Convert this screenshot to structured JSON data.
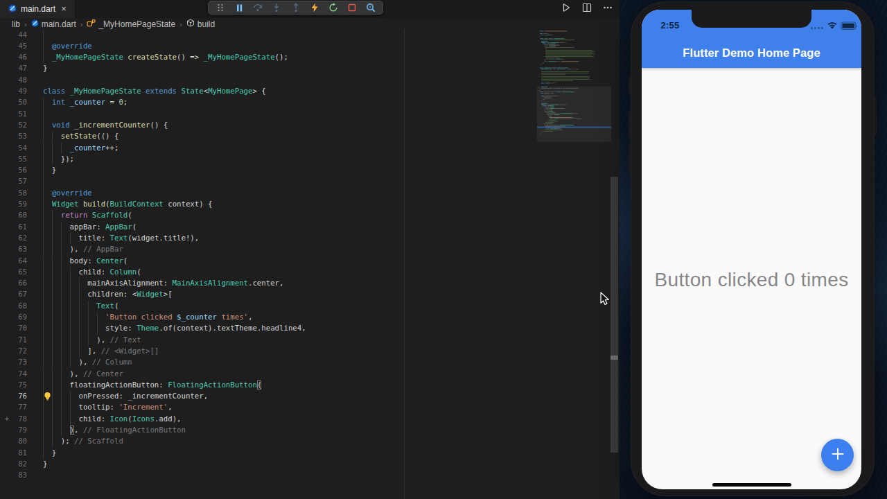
{
  "colors": {
    "p": "#d4d4d4",
    "k": "#569cd6",
    "c": "#c586c0",
    "t": "#4ec9b0",
    "f": "#dcdcaa",
    "v": "#9cdcfe",
    "n": "#b5cea8",
    "s": "#ce9178",
    "m": "#7a7a7a"
  },
  "vscode": {
    "tab": {
      "title": "main.dart"
    },
    "breadcrumbs": [
      {
        "label": "lib",
        "icon": null
      },
      {
        "label": "main.dart",
        "icon": "dart"
      },
      {
        "label": "_MyHomePageState",
        "icon": "class"
      },
      {
        "label": "build",
        "icon": "method"
      }
    ],
    "debug_toolbar": [
      "drag-handle",
      "pause",
      "step-over",
      "step-into",
      "step-out",
      "hot-reload",
      "restart",
      "stop",
      "open-devtools"
    ],
    "editor_actions": [
      "run",
      "split-editor",
      "more-actions"
    ],
    "code": {
      "first_line": 44,
      "last_line": 83,
      "active_line": 76,
      "lines": [
        {
          "n": 44,
          "guides": 1,
          "segs": []
        },
        {
          "n": 45,
          "guides": 1,
          "segs": [
            [
              "p",
              "  "
            ],
            [
              "k",
              "@override"
            ]
          ]
        },
        {
          "n": 46,
          "guides": 1,
          "segs": [
            [
              "p",
              "  "
            ],
            [
              "t",
              "_MyHomePageState"
            ],
            [
              "p",
              " "
            ],
            [
              "f",
              "createState"
            ],
            [
              "p",
              "() => "
            ],
            [
              "t",
              "_MyHomePageState"
            ],
            [
              "p",
              "();"
            ]
          ]
        },
        {
          "n": 47,
          "guides": 0,
          "segs": [
            [
              "p",
              "}"
            ]
          ]
        },
        {
          "n": 48,
          "guides": 0,
          "segs": []
        },
        {
          "n": 49,
          "guides": 0,
          "segs": [
            [
              "k",
              "class"
            ],
            [
              "p",
              " "
            ],
            [
              "t",
              "_MyHomePageState"
            ],
            [
              "p",
              " "
            ],
            [
              "k",
              "extends"
            ],
            [
              "p",
              " "
            ],
            [
              "t",
              "State"
            ],
            [
              "p",
              "<"
            ],
            [
              "t",
              "MyHomePage"
            ],
            [
              "p",
              "> {"
            ]
          ]
        },
        {
          "n": 50,
          "guides": 1,
          "segs": [
            [
              "p",
              "  "
            ],
            [
              "k",
              "int"
            ],
            [
              "p",
              " "
            ],
            [
              "v",
              "_counter"
            ],
            [
              "p",
              " = "
            ],
            [
              "n",
              "0"
            ],
            [
              "p",
              ";"
            ]
          ]
        },
        {
          "n": 51,
          "guides": 1,
          "segs": []
        },
        {
          "n": 52,
          "guides": 1,
          "segs": [
            [
              "p",
              "  "
            ],
            [
              "k",
              "void"
            ],
            [
              "p",
              " "
            ],
            [
              "f",
              "_incrementCounter"
            ],
            [
              "p",
              "() {"
            ]
          ]
        },
        {
          "n": 53,
          "guides": 2,
          "segs": [
            [
              "p",
              "    "
            ],
            [
              "f",
              "setState"
            ],
            [
              "p",
              "(() {"
            ]
          ]
        },
        {
          "n": 54,
          "guides": 3,
          "segs": [
            [
              "p",
              "      "
            ],
            [
              "v",
              "_counter"
            ],
            [
              "p",
              "++;"
            ]
          ]
        },
        {
          "n": 55,
          "guides": 2,
          "segs": [
            [
              "p",
              "    });"
            ]
          ]
        },
        {
          "n": 56,
          "guides": 1,
          "segs": [
            [
              "p",
              "  }"
            ]
          ]
        },
        {
          "n": 57,
          "guides": 1,
          "segs": []
        },
        {
          "n": 58,
          "guides": 1,
          "segs": [
            [
              "p",
              "  "
            ],
            [
              "k",
              "@override"
            ]
          ]
        },
        {
          "n": 59,
          "guides": 1,
          "segs": [
            [
              "p",
              "  "
            ],
            [
              "t",
              "Widget"
            ],
            [
              "p",
              " "
            ],
            [
              "f",
              "build"
            ],
            [
              "p",
              "("
            ],
            [
              "t",
              "BuildContext"
            ],
            [
              "p",
              " context) {"
            ]
          ]
        },
        {
          "n": 60,
          "guides": 2,
          "segs": [
            [
              "p",
              "    "
            ],
            [
              "c",
              "return"
            ],
            [
              "p",
              " "
            ],
            [
              "t",
              "Scaffold"
            ],
            [
              "p",
              "("
            ]
          ]
        },
        {
          "n": 61,
          "guides": 3,
          "segs": [
            [
              "p",
              "      appBar: "
            ],
            [
              "t",
              "AppBar"
            ],
            [
              "p",
              "("
            ]
          ]
        },
        {
          "n": 62,
          "guides": 4,
          "segs": [
            [
              "p",
              "        title: "
            ],
            [
              "t",
              "Text"
            ],
            [
              "p",
              "(widget.title!),"
            ]
          ]
        },
        {
          "n": 63,
          "guides": 3,
          "segs": [
            [
              "p",
              "      ), "
            ],
            [
              "m",
              "// AppBar"
            ]
          ]
        },
        {
          "n": 64,
          "guides": 3,
          "segs": [
            [
              "p",
              "      body: "
            ],
            [
              "t",
              "Center"
            ],
            [
              "p",
              "("
            ]
          ]
        },
        {
          "n": 65,
          "guides": 4,
          "segs": [
            [
              "p",
              "        child: "
            ],
            [
              "t",
              "Column"
            ],
            [
              "p",
              "("
            ]
          ]
        },
        {
          "n": 66,
          "guides": 5,
          "segs": [
            [
              "p",
              "          mainAxisAlignment: "
            ],
            [
              "t",
              "MainAxisAlignment"
            ],
            [
              "p",
              ".center,"
            ]
          ]
        },
        {
          "n": 67,
          "guides": 5,
          "segs": [
            [
              "p",
              "          children: <"
            ],
            [
              "t",
              "Widget"
            ],
            [
              "p",
              ">["
            ]
          ]
        },
        {
          "n": 68,
          "guides": 6,
          "segs": [
            [
              "p",
              "            "
            ],
            [
              "t",
              "Text"
            ],
            [
              "p",
              "("
            ]
          ]
        },
        {
          "n": 69,
          "guides": 7,
          "segs": [
            [
              "p",
              "              "
            ],
            [
              "s",
              "'Button clicked "
            ],
            [
              "v",
              "$_counter"
            ],
            [
              "s",
              " times'"
            ],
            [
              "p",
              ","
            ]
          ]
        },
        {
          "n": 70,
          "guides": 7,
          "segs": [
            [
              "p",
              "              style: "
            ],
            [
              "t",
              "Theme"
            ],
            [
              "p",
              ".of(context).textTheme.headline4,"
            ]
          ]
        },
        {
          "n": 71,
          "guides": 6,
          "segs": [
            [
              "p",
              "            ), "
            ],
            [
              "m",
              "// Text"
            ]
          ]
        },
        {
          "n": 72,
          "guides": 5,
          "segs": [
            [
              "p",
              "          ], "
            ],
            [
              "m",
              "// <Widget>[]"
            ]
          ]
        },
        {
          "n": 73,
          "guides": 4,
          "segs": [
            [
              "p",
              "        ), "
            ],
            [
              "m",
              "// Column"
            ]
          ]
        },
        {
          "n": 74,
          "guides": 3,
          "segs": [
            [
              "p",
              "      ), "
            ],
            [
              "m",
              "// Center"
            ]
          ]
        },
        {
          "n": 75,
          "guides": 3,
          "segs": [
            [
              "p",
              "      floatingActionButton: "
            ],
            [
              "t",
              "FloatingActionButton"
            ],
            [
              "p",
              "(",
              "box"
            ]
          ]
        },
        {
          "n": 76,
          "guides": 4,
          "segs": [
            [
              "p",
              "        onPressed: _incrementCounter,"
            ]
          ],
          "bulb": true
        },
        {
          "n": 77,
          "guides": 4,
          "segs": [
            [
              "p",
              "        tooltip: "
            ],
            [
              "s",
              "'Increment'"
            ],
            [
              "p",
              ","
            ]
          ]
        },
        {
          "n": 78,
          "guides": 4,
          "segs": [
            [
              "p",
              "        child: "
            ],
            [
              "t",
              "Icon"
            ],
            [
              "p",
              "("
            ],
            [
              "t",
              "Icons"
            ],
            [
              "p",
              ".add),"
            ]
          ],
          "gutter_plus": true
        },
        {
          "n": 79,
          "guides": 3,
          "segs": [
            [
              "p",
              "      "
            ],
            [
              "p",
              ")",
              "box"
            ],
            [
              "p",
              ", "
            ],
            [
              "m",
              "// FloatingActionButton"
            ]
          ]
        },
        {
          "n": 80,
          "guides": 2,
          "segs": [
            [
              "p",
              "    ); "
            ],
            [
              "m",
              "// Scaffold"
            ]
          ]
        },
        {
          "n": 81,
          "guides": 1,
          "segs": [
            [
              "p",
              "  }"
            ]
          ]
        },
        {
          "n": 82,
          "guides": 0,
          "segs": [
            [
              "p",
              "}"
            ]
          ]
        },
        {
          "n": 83,
          "guides": 0,
          "segs": []
        }
      ]
    },
    "minimap_head_lines": [
      "import 'package:flutter/material.dart';",
      "",
      "void main() {",
      "  runApp(MyApp());",
      "}",
      "",
      "class MyApp extends StatelessWidget {",
      "  // This widget is the root of your application.",
      "  @override",
      "  Widget build(BuildContext context) {",
      "    return MaterialApp(",
      "      title: 'Flutter Demo',",
      "      theme: ThemeData(",
      "        // This is the theme of your application.",
      "        //",
      "        // Try running your application with \"flutter run\". You'll see the",
      "        // application has a blue toolbar. Then, without quitting the app, try",
      "        // changing the primarySwatch below to Colors.green and then invoke",
      "        // \"hot reload\" (press \"r\" in the console where you ran \"flutter run\",",
      "        // or simply save your changes to \"hot reload\" in a Flutter IDE).",
      "        // Notice that the counter didn't reset back to zero; the application",
      "        // is not restarted.",
      "        primarySwatch: Colors.blue,",
      "      ),",
      "      home: MyHomePage(title: 'Flutter Demo Home Page'),",
      "    );",
      "  }",
      "}",
      "",
      "class MyHomePage extends StatefulWidget {",
      "  MyHomePage({Key? key, this.title}) : super(key: key);",
      "",
      "  // This widget is the home page of your application. It is stateful,",
      "  // meaning that it has a State object (defined below) that contains",
      "  // fields that affect how it looks.",
      "",
      "  // This class is the configuration for the state. It holds the values",
      "  // (in this case the title) provided by the parent (in this case the",
      "  // App widget) and used by the build method of the State. Fields in a",
      "  // Widget subclass are always marked \"final\".",
      "",
      "  final String? title;",
      ""
    ]
  },
  "simulator": {
    "status_bar": {
      "time": "2:55"
    },
    "app_bar": {
      "title": "Flutter Demo Home Page",
      "color": "#3f80ea"
    },
    "body": {
      "counter_text": "Button clicked 0 times"
    },
    "fab": {
      "icon": "plus",
      "color": "#3e7ff0"
    }
  }
}
